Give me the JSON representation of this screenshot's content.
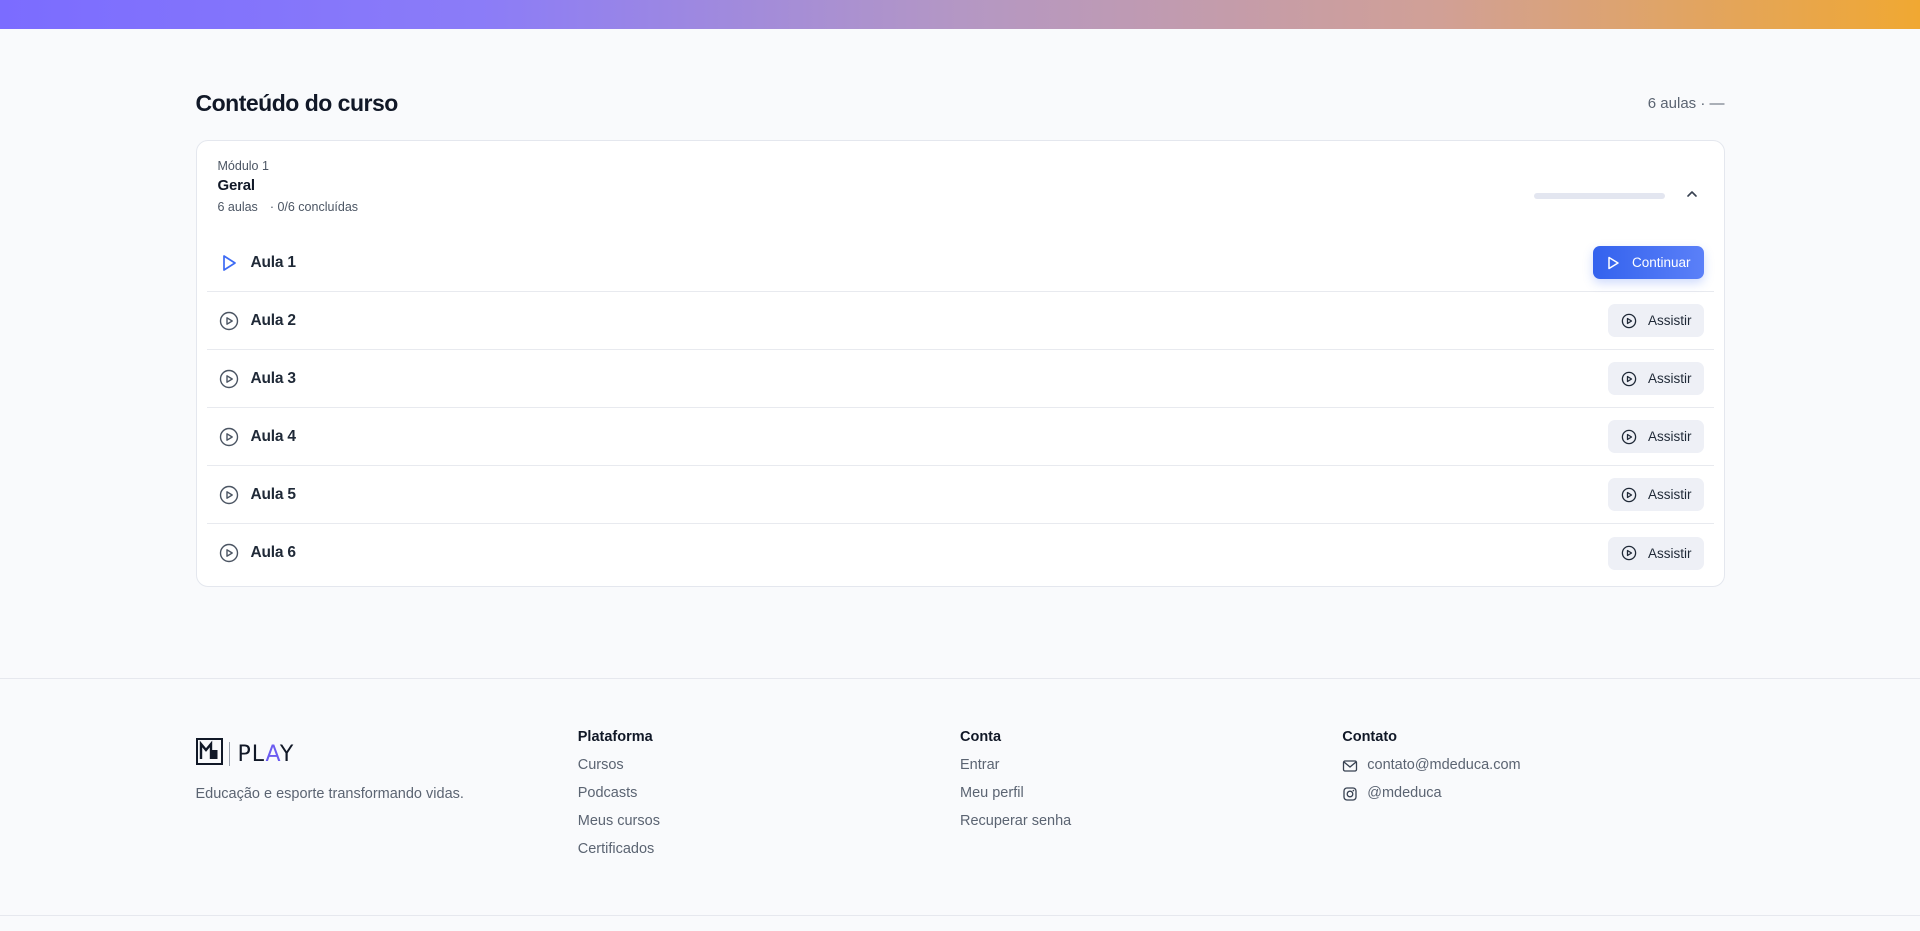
{
  "course": {
    "title": "Conteúdo do curso",
    "meta": "6 aulas · —"
  },
  "module": {
    "label": "Módulo 1",
    "name": "Geral",
    "lessons_count": "6 aulas",
    "completed": "· 0/6 concluídas",
    "progress_fraction": 0,
    "icons": {
      "collapse": "chevron-up-icon"
    }
  },
  "lessons": [
    {
      "title": "Aula 1",
      "action": "Continuar",
      "icon": "play-icon",
      "active": true
    },
    {
      "title": "Aula 2",
      "action": "Assistir",
      "icon": "play-circle-icon",
      "active": false
    },
    {
      "title": "Aula 3",
      "action": "Assistir",
      "icon": "play-circle-icon",
      "active": false
    },
    {
      "title": "Aula 4",
      "action": "Assistir",
      "icon": "play-circle-icon",
      "active": false
    },
    {
      "title": "Aula 5",
      "action": "Assistir",
      "icon": "play-circle-icon",
      "active": false
    },
    {
      "title": "Aula 6",
      "action": "Assistir",
      "icon": "play-circle-icon",
      "active": false
    }
  ],
  "footer": {
    "brand": {
      "logo_text": "PLAY",
      "tagline": "Educação e esporte transformando vidas."
    },
    "platform": {
      "title": "Plataforma",
      "links": [
        "Cursos",
        "Podcasts",
        "Meus cursos",
        "Certificados"
      ]
    },
    "account": {
      "title": "Conta",
      "links": [
        "Entrar",
        "Meu perfil",
        "Recuperar senha"
      ]
    },
    "contact": {
      "title": "Contato",
      "email": "contato@mdeduca.com",
      "instagram": "@mdeduca",
      "icons": {
        "email": "mail-icon",
        "instagram": "instagram-icon"
      }
    }
  },
  "colors": {
    "primary": "#3d6bf4",
    "gradient_start": "#7b6cff",
    "gradient_end": "#f0a832",
    "background": "#f9fafc"
  }
}
